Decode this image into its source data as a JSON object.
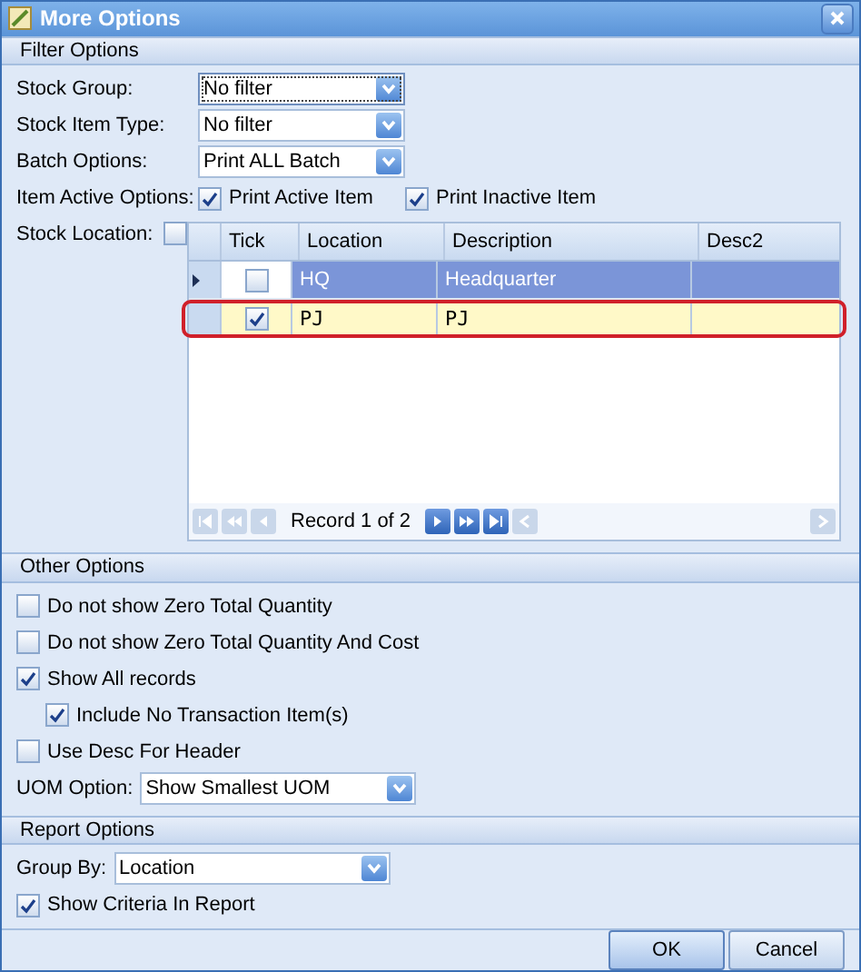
{
  "window": {
    "title": "More Options"
  },
  "filter_options": {
    "title": "Filter Options",
    "dropdowns": [
      {
        "label": "Stock Group:",
        "value": "No filter",
        "focused": true
      },
      {
        "label": "Stock Item Type:",
        "value": "No filter",
        "focused": false
      },
      {
        "label": "Batch Options:",
        "value": "Print ALL Batch",
        "focused": false
      }
    ],
    "item_active": {
      "label": "Item Active Options:",
      "options": [
        {
          "label": "Print Active Item",
          "checked": true
        },
        {
          "label": "Print Inactive Item",
          "checked": true
        }
      ]
    },
    "stock_location": {
      "label": "Stock Location:",
      "checked": false,
      "tick_column": "Tick",
      "columns": [
        "Location",
        "Description",
        "Desc2"
      ],
      "rows": [
        {
          "selected": true,
          "outlined": false,
          "checked": false,
          "cells": [
            "HQ",
            "Headquarter"
          ]
        },
        {
          "selected": false,
          "outlined": true,
          "checked": true,
          "cells": [
            "PJ",
            "PJ"
          ]
        }
      ],
      "navigator": {
        "text": "Record 1 of 2",
        "buttons": [
          {
            "kind": "first",
            "disabled": true
          },
          {
            "kind": "prev-page",
            "disabled": true
          },
          {
            "kind": "prev",
            "disabled": true
          },
          {
            "kind": "next",
            "disabled": false
          },
          {
            "kind": "next-page",
            "disabled": false
          },
          {
            "kind": "last",
            "disabled": false
          }
        ]
      }
    }
  },
  "other_options": {
    "title": "Other Options",
    "items": [
      {
        "kind": "checkbox",
        "label": "Do not show Zero Total Quantity",
        "checked": false,
        "nested": false
      },
      {
        "kind": "checkbox",
        "label": "Do not show Zero Total Quantity And Cost",
        "checked": false,
        "nested": false
      },
      {
        "kind": "checkbox",
        "label": "Show All records",
        "checked": true,
        "nested": false
      },
      {
        "kind": "checkbox",
        "label": "Include No Transaction Item(s)",
        "checked": true,
        "nested": true
      },
      {
        "kind": "checkbox",
        "label": "Use Desc For Header",
        "checked": false,
        "nested": false
      },
      {
        "kind": "dropdown",
        "label": "UOM Option:",
        "value": "Show Smallest UOM"
      }
    ]
  },
  "report_options": {
    "title": "Report Options",
    "items": [
      {
        "kind": "dropdown",
        "label": "Group By:",
        "value": "Location"
      },
      {
        "kind": "checkbox",
        "label": "Show Criteria In Report",
        "checked": true,
        "nested": false
      }
    ]
  },
  "buttons": [
    {
      "label": "OK",
      "default": true
    },
    {
      "label": "Cancel",
      "default": false
    }
  ]
}
